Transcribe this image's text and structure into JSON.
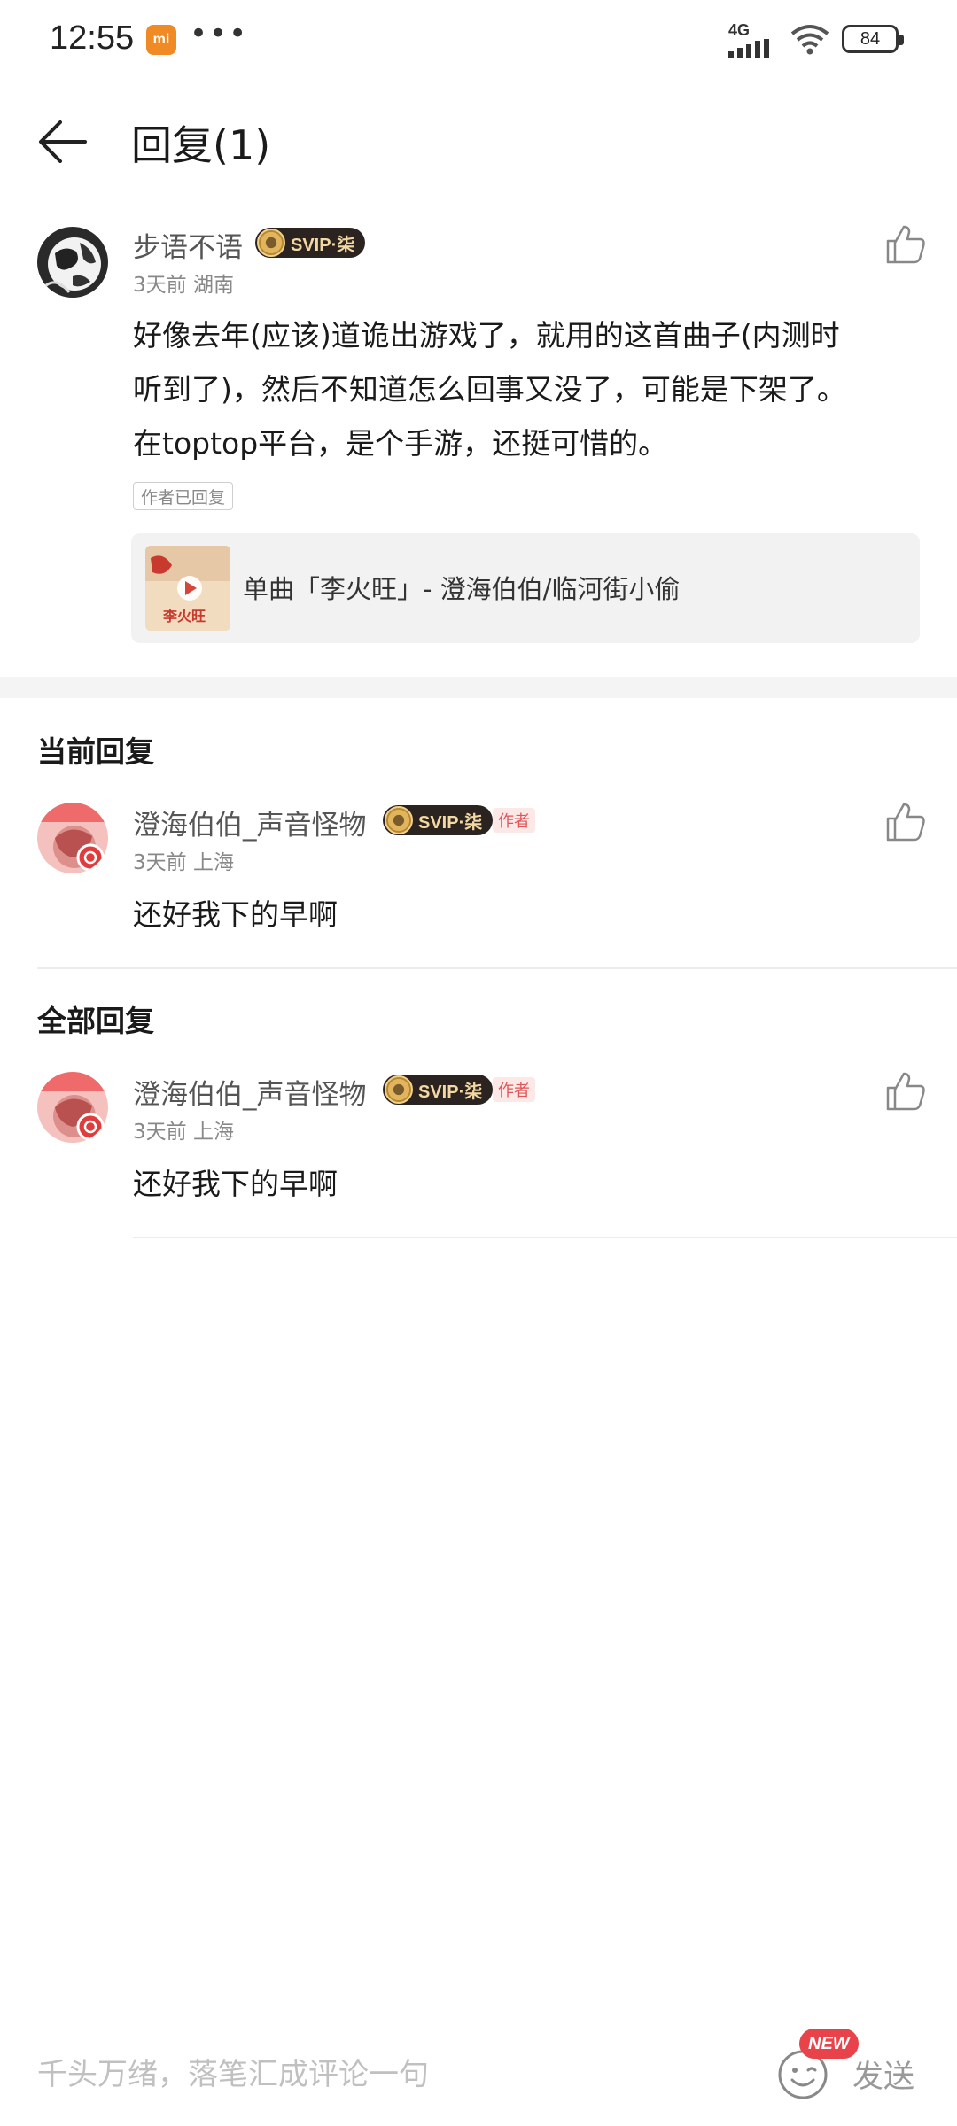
{
  "status_bar": {
    "time": "12:55",
    "app_badge": "mi",
    "more": "•••",
    "network": "4G",
    "battery": "84"
  },
  "header": {
    "title": "回复(1)"
  },
  "original_comment": {
    "username": "步语不语",
    "vip_label": "SVIP·柒",
    "meta": "3天前 湖南",
    "text_lines": [
      "好像去年(应该)道诡出游戏了，就用的这首曲子(内测时",
      "听到了)，然后不知道怎么回事又没了，可能是下架了。",
      "在toptop平台，是个手游，还挺可惜的。"
    ],
    "replied_tag": "作者已回复",
    "song_card": {
      "title": "单曲「李火旺」- 澄海伯伯/临河街小偷",
      "cover_text": "李火旺"
    }
  },
  "current_reply": {
    "section_title": "当前回复",
    "username": "澄海伯伯_声音怪物",
    "vip_label": "SVIP·柒",
    "author_tag": "作者",
    "meta": "3天前 上海",
    "text": "还好我下的早啊"
  },
  "all_replies": {
    "section_title": "全部回复",
    "items": [
      {
        "username": "澄海伯伯_声音怪物",
        "vip_label": "SVIP·柒",
        "author_tag": "作者",
        "meta": "3天前 上海",
        "text": "还好我下的早啊"
      }
    ]
  },
  "input_bar": {
    "placeholder": "千头万绪，落笔汇成评论一句",
    "new_badge": "NEW",
    "send_label": "发送"
  },
  "colors": {
    "vip_bg": "#2b2320",
    "vip_text": "#f3d8a4",
    "author_tag_bg": "#fde8e8",
    "author_tag_text": "#e05555",
    "new_badge": "#e8434a"
  }
}
